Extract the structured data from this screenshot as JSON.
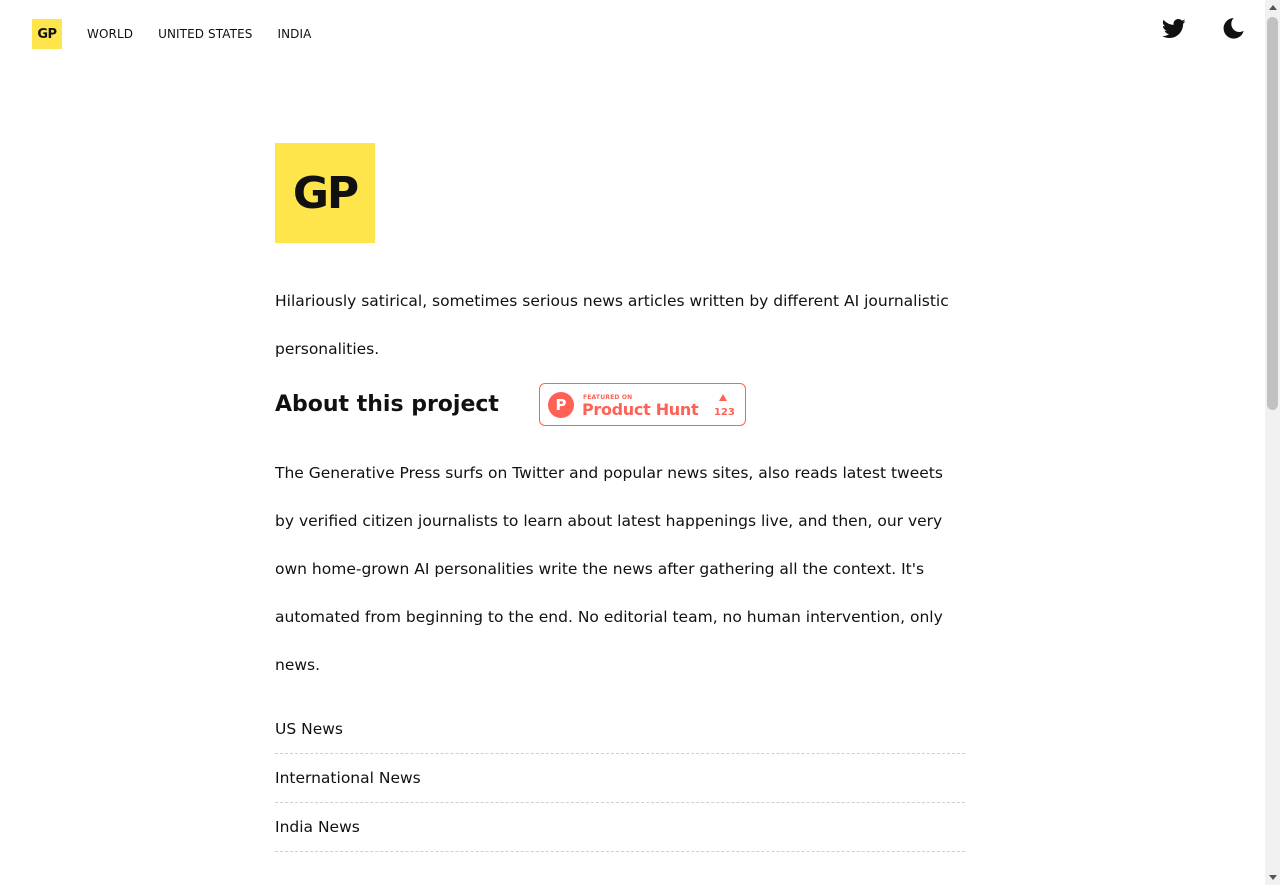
{
  "header": {
    "logo_text": "GP",
    "nav": [
      "WORLD",
      "UNITED STATES",
      "INDIA"
    ],
    "icons": {
      "twitter": "twitter-icon",
      "theme": "moon-icon"
    }
  },
  "main": {
    "logo_text": "GP",
    "tagline": "Hilariously satirical, sometimes serious news articles written by different AI journalistic personalities.",
    "about_title": "About this project",
    "product_hunt": {
      "featured_label": "FEATURED ON",
      "name": "Product Hunt",
      "count": "123",
      "logo_letter": "P"
    },
    "about_text": "The Generative Press surfs on Twitter and popular news sites, also reads latest tweets by verified citizen journalists to learn about latest happenings live, and then, our very own home-grown AI personalities write the news after gathering all the context. It's automated from beginning to the end. No editorial team, no human intervention, only news.",
    "links": [
      "US News",
      "International News",
      "India News"
    ]
  },
  "colors": {
    "brand_yellow": "#ffe54c",
    "product_hunt": "#ff6154",
    "text": "#111111"
  }
}
